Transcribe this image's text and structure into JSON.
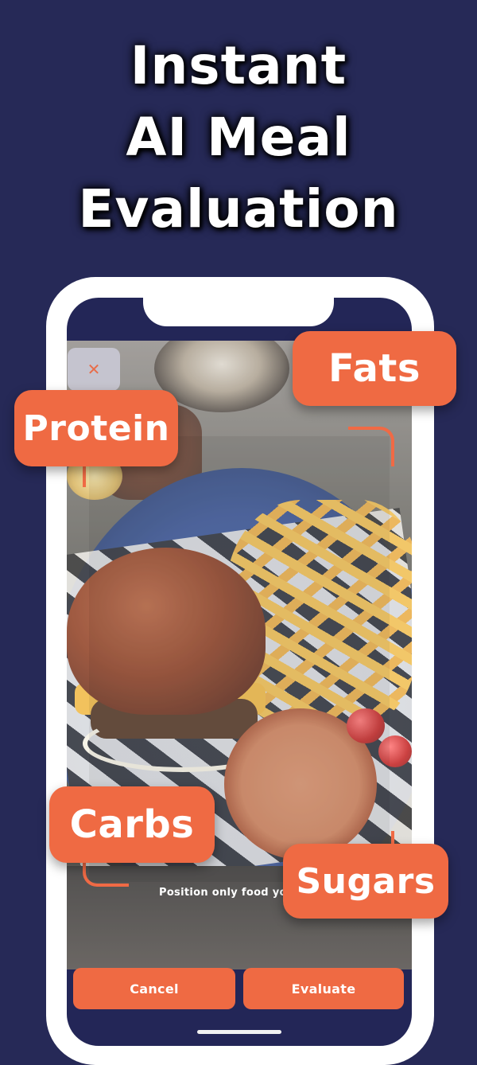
{
  "headline": {
    "line1": "Instant",
    "line2": "AI Meal",
    "line3": "Evaluation"
  },
  "camera": {
    "close_icon": "close-icon",
    "hint": "Position only food yo"
  },
  "tags": {
    "fats": "Fats",
    "protein": "Protein",
    "carbs": "Carbs",
    "sugars": "Sugars"
  },
  "actions": {
    "cancel": "Cancel",
    "evaluate": "Evaluate"
  },
  "colors": {
    "background": "#262957",
    "accent": "#ef6a43",
    "phone_frame": "#ffffff"
  }
}
